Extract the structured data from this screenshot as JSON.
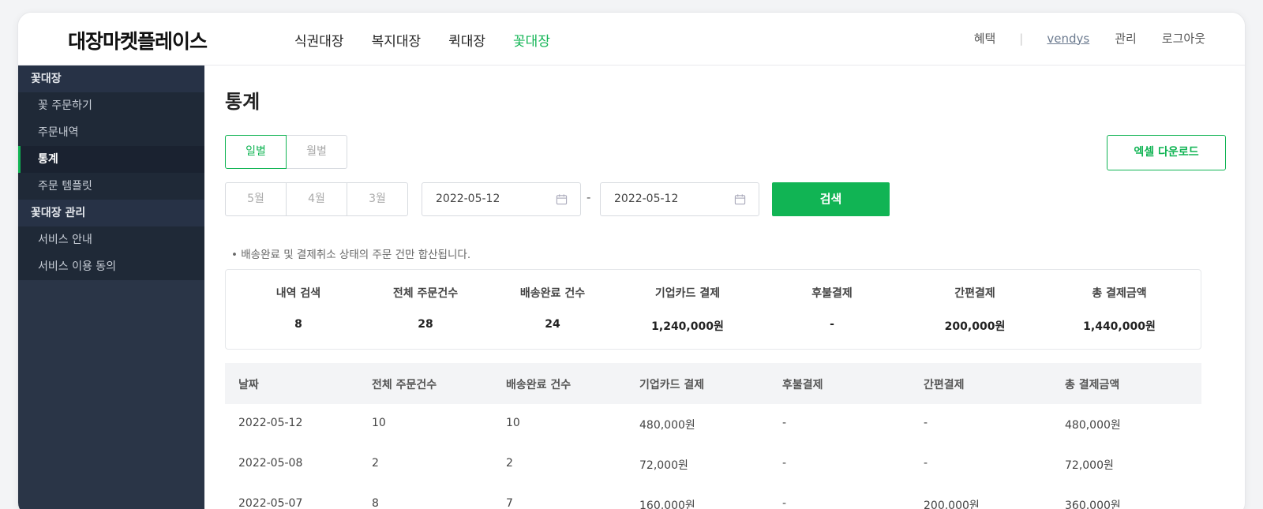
{
  "header": {
    "logo": "대장마켓플레이스",
    "nav": [
      "식권대장",
      "복지대장",
      "퀵대장",
      "꽃대장"
    ],
    "nav_active": 3,
    "util": {
      "benefit": "혜택",
      "separator": "|",
      "user": "vendys",
      "manage": "관리",
      "logout": "로그아웃"
    }
  },
  "sidebar": {
    "groups": [
      {
        "title": "꽃대장",
        "items": [
          "꽃 주문하기",
          "주문내역",
          "통계",
          "주문 템플릿"
        ]
      },
      {
        "title": "꽃대장 관리",
        "items": [
          "서비스 안내",
          "서비스 이용 동의"
        ]
      }
    ],
    "active_item": "통계"
  },
  "main": {
    "title": "통계",
    "mode_tabs": [
      "일별",
      "월별"
    ],
    "mode_active": 0,
    "month_tabs": [
      "5월",
      "4월",
      "3월"
    ],
    "date_from": "2022-05-12",
    "date_to": "2022-05-12",
    "date_separator": "-",
    "search_label": "검색",
    "excel_label": "엑셀 다운로드",
    "notice": "•  배송완료 및 결제취소 상태의 주문 건만 합산됩니다."
  },
  "summary": {
    "labels": [
      "내역 검색",
      "전체 주문건수",
      "배송완료 건수",
      "기업카드 결제",
      "후불결제",
      "간편결제",
      "총 결제금액"
    ],
    "values": [
      "8",
      "28",
      "24",
      "1,240,000원",
      "-",
      "200,000원",
      "1,440,000원"
    ]
  },
  "table": {
    "headers": [
      "날짜",
      "전체 주문건수",
      "배송완료 건수",
      "기업카드 결제",
      "후불결제",
      "간편결제",
      "총 결제금액"
    ],
    "rows": [
      [
        "2022-05-12",
        "10",
        "10",
        "480,000원",
        "-",
        "-",
        "480,000원"
      ],
      [
        "2022-05-08",
        "2",
        "2",
        "72,000원",
        "-",
        "-",
        "72,000원"
      ],
      [
        "2022-05-07",
        "8",
        "7",
        "160,000원",
        "-",
        "200,000원",
        "360,000원"
      ]
    ]
  },
  "colors": {
    "accent": "#11b454",
    "sidebar_bg": "#2a3547"
  }
}
